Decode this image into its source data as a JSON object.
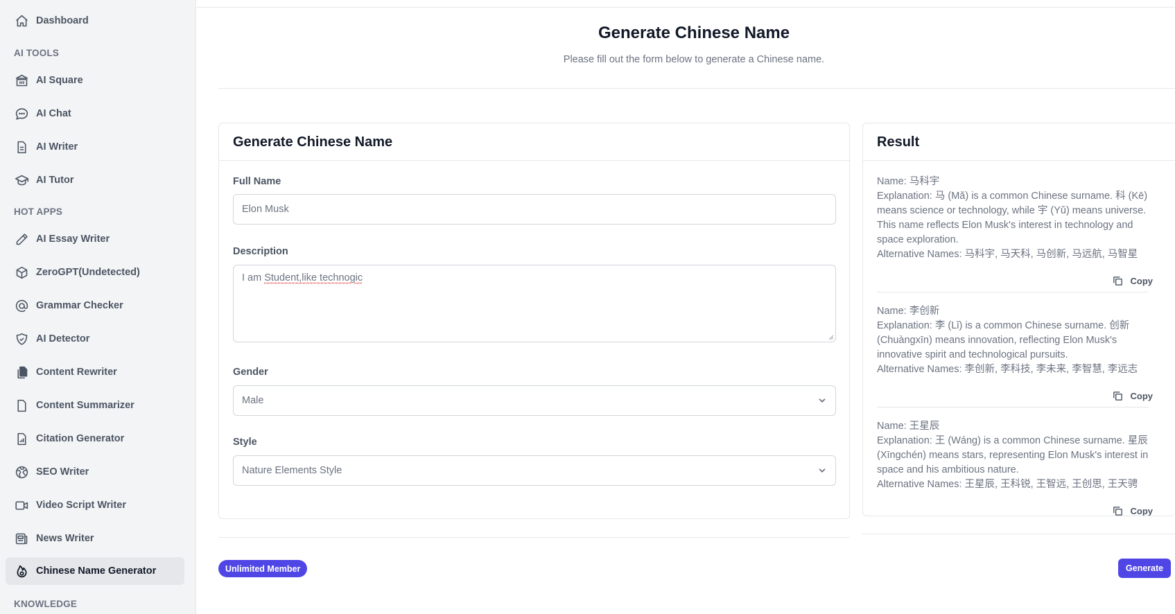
{
  "sidebar": {
    "dashboard": "Dashboard",
    "sections": {
      "ai_tools": "AI TOOLS",
      "hot_apps": "HOT APPS",
      "knowledge": "KNOWLEDGE"
    },
    "ai_tools": [
      {
        "label": "AI Square",
        "icon": "bank-icon"
      },
      {
        "label": "AI Chat",
        "icon": "chat-bubble-icon"
      },
      {
        "label": "AI Writer",
        "icon": "document-text-icon"
      },
      {
        "label": "AI Tutor",
        "icon": "graduation-cap-icon"
      }
    ],
    "hot_apps": [
      {
        "label": "AI Essay Writer",
        "icon": "pencil-icon"
      },
      {
        "label": "ZeroGPT(Undetected)",
        "icon": "cube-icon"
      },
      {
        "label": "Grammar Checker",
        "icon": "at-sign-icon"
      },
      {
        "label": "AI Detector",
        "icon": "shield-check-icon"
      },
      {
        "label": "Content Rewriter",
        "icon": "documents-icon"
      },
      {
        "label": "Content Summarizer",
        "icon": "document-icon"
      },
      {
        "label": "Citation Generator",
        "icon": "chart-document-icon"
      },
      {
        "label": "SEO Writer",
        "icon": "globe-icon"
      },
      {
        "label": "Video Script Writer",
        "icon": "video-camera-icon"
      },
      {
        "label": "News Writer",
        "icon": "newspaper-icon"
      },
      {
        "label": "Chinese Name Generator",
        "icon": "fire-icon",
        "active": true
      }
    ]
  },
  "header": {
    "title": "Generate Chinese Name",
    "subtitle": "Please fill out the form below to generate a Chinese name."
  },
  "form": {
    "title": "Generate Chinese Name",
    "full_name_label": "Full Name",
    "full_name_value": "Elon Musk",
    "description_label": "Description",
    "description_prefix": "I am ",
    "description_misspelled": "Student,like technogic",
    "gender_label": "Gender",
    "gender_value": "Male",
    "style_label": "Style",
    "style_value": "Nature Elements Style"
  },
  "result": {
    "title": "Result",
    "copy_label": "Copy",
    "items": [
      {
        "name": "Name: 马科宇",
        "explanation": "Explanation: 马 (Mǎ) is a common Chinese surname. 科 (Kē) means science or technology, while 宇 (Yǔ) means universe. This name reflects Elon Musk's interest in technology and space exploration.",
        "alternatives": "Alternative Names: 马科宇, 马天科, 马创新, 马远航, 马智星"
      },
      {
        "name": "Name: 李创新",
        "explanation": "Explanation: 李 (Lǐ) is a common Chinese surname. 创新 (Chuàngxīn) means innovation, reflecting Elon Musk's innovative spirit and technological pursuits.",
        "alternatives": "Alternative Names: 李创新, 李科技, 李未来, 李智慧, 李远志"
      },
      {
        "name": "Name: 王星辰",
        "explanation": "Explanation: 王 (Wáng) is a common Chinese surname. 星辰 (Xīngchén) means stars, representing Elon Musk's interest in space and his ambitious nature.",
        "alternatives": "Alternative Names: 王星辰, 王科锐, 王智远, 王创思, 王天骋"
      }
    ]
  },
  "footer": {
    "member_badge": "Unlimited Member",
    "generate_label": "Generate"
  },
  "colors": {
    "accent": "#4f46e5",
    "sidebar_bg": "#f3f4f6",
    "active_item_bg": "#e5e7eb"
  }
}
